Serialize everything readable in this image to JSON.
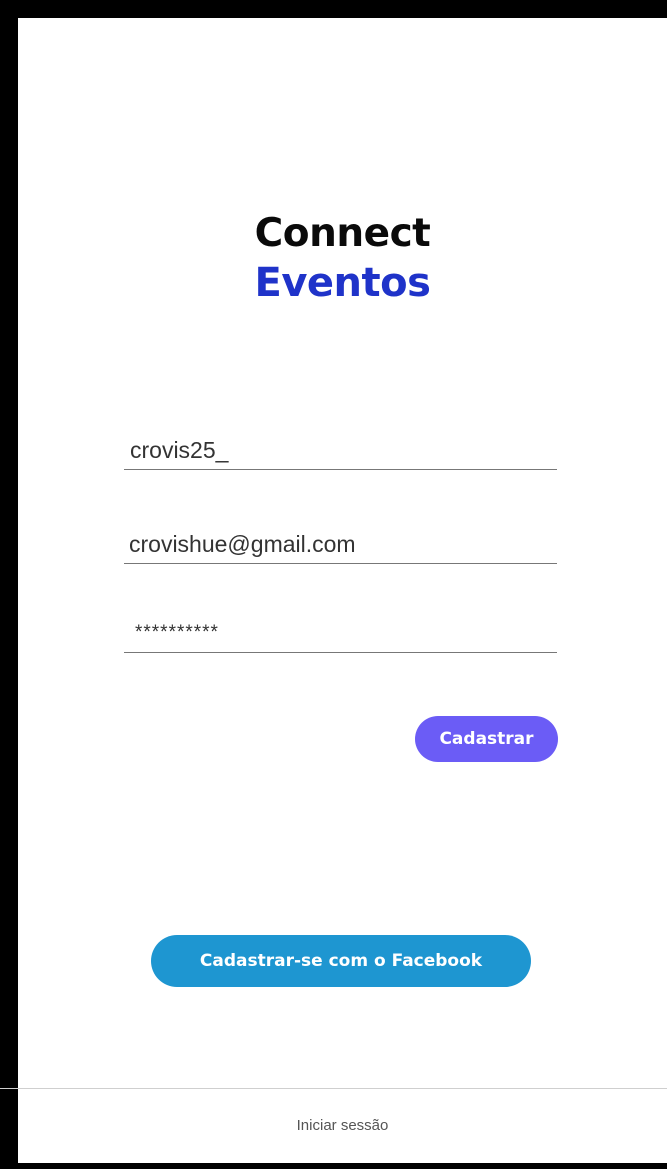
{
  "app": {
    "logo_line1": "Connect",
    "logo_line2": "Eventos"
  },
  "form": {
    "username_value": "crovis25_",
    "email_value": "crovishue@gmail.com",
    "password_value": "**********",
    "register_label": "Cadastrar"
  },
  "social": {
    "facebook_label": "Cadastrar-se com o Facebook"
  },
  "footer": {
    "signin_label": "Iniciar sessão"
  },
  "colors": {
    "logo_primary": "#0a0a0a",
    "logo_accent": "#1f33c9",
    "register_button": "#6b5cf6",
    "facebook_button": "#1e96d1"
  }
}
